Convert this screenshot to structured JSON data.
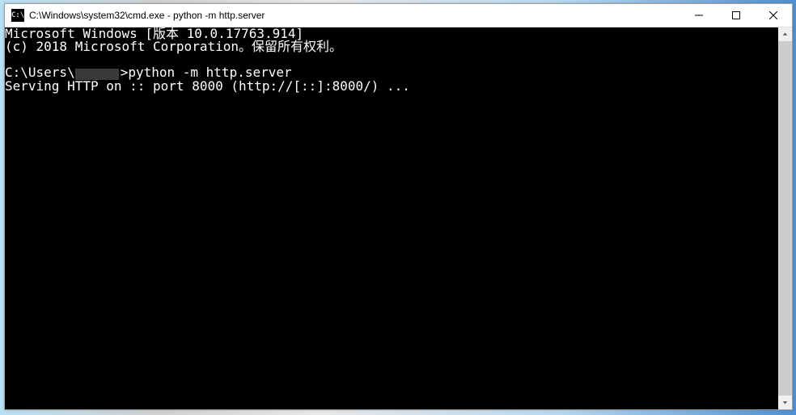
{
  "titlebar": {
    "icon_label": "C:\\",
    "title": "C:\\Windows\\system32\\cmd.exe - python  -m http.server"
  },
  "terminal": {
    "line1": "Microsoft Windows [版本 10.0.17763.914]",
    "line2": "(c) 2018 Microsoft Corporation。保留所有权利。",
    "line3_prefix": "C:\\Users\\",
    "line3_suffix": ">python -m http.server",
    "line4": "Serving HTTP on :: port 8000 (http://[::]:8000/) ..."
  }
}
